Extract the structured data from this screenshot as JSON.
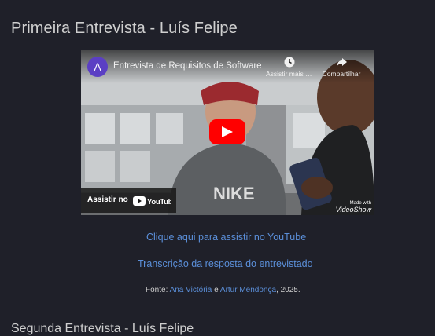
{
  "page": {
    "title": "Primeira Entrevista - Luís Felipe"
  },
  "video": {
    "channel_initial": "A",
    "title": "Entrevista de Requisitos de Software",
    "watch_later_label": "Assistir mais tarde",
    "share_label": "Compartilhar",
    "watch_on_label": "Assistir no",
    "youtube_word": "YouTube",
    "watermark_small": "Made with",
    "watermark_big": "VideoShow",
    "colors": {
      "play_button": "#ff0000",
      "avatar": "#5b3fc4"
    }
  },
  "links": {
    "youtube": "Clique aqui para assistir no YouTube",
    "transcript": "Transcrição da resposta do entrevistado"
  },
  "source": {
    "prefix": "Fonte: ",
    "author1": "Ana Victória",
    "joiner": " e ",
    "author2": "Artur Mendonça",
    "suffix": ", 2025."
  },
  "next_section": {
    "heading": "Segunda Entrevista - Luís Felipe"
  }
}
